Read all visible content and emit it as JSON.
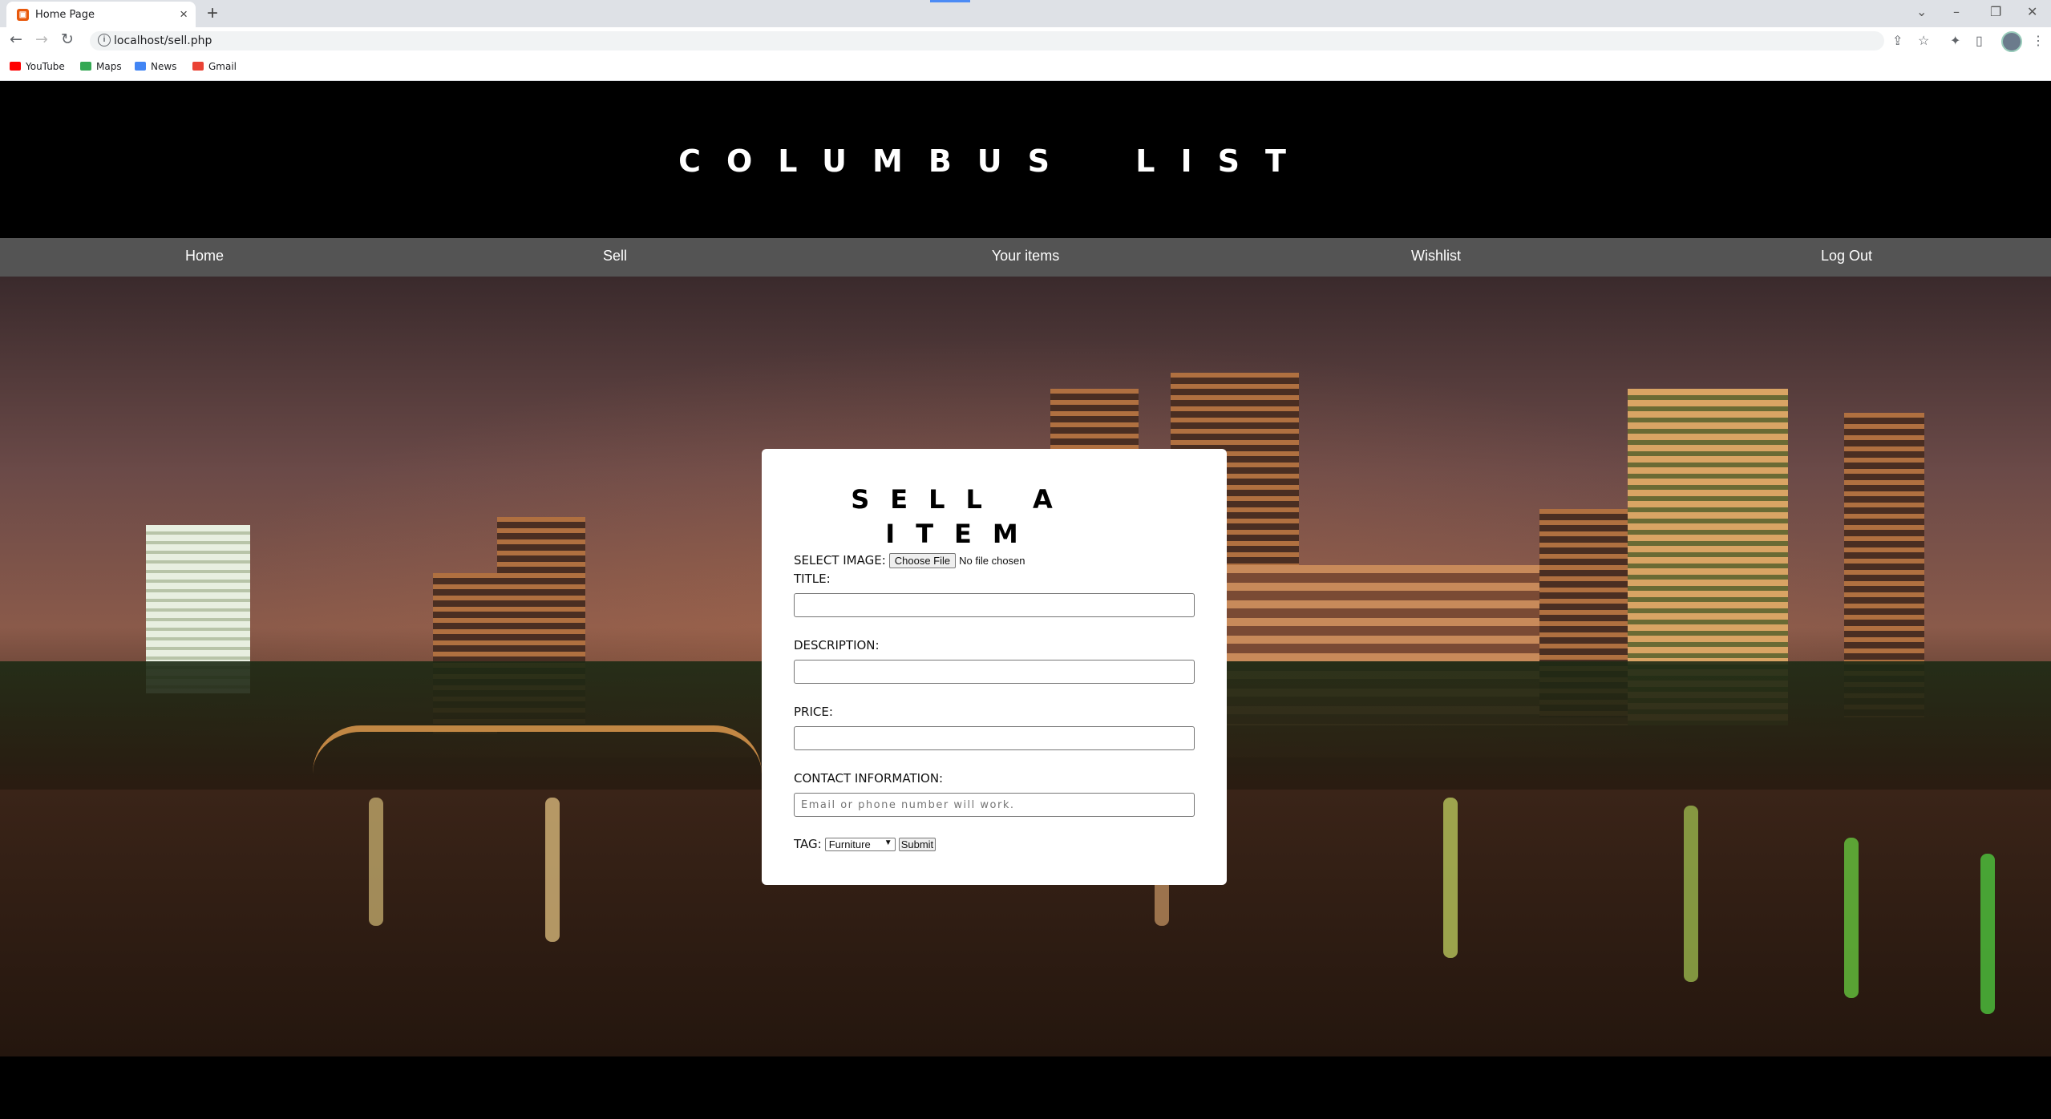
{
  "browser": {
    "tab_title": "Home Page",
    "url": "localhost/sell.php",
    "bookmarks": [
      "YouTube",
      "Maps",
      "News",
      "Gmail"
    ]
  },
  "site": {
    "title": "COLUMBUS LIST",
    "nav": [
      "Home",
      "Sell",
      "Your items",
      "Wishlist",
      "Log Out"
    ]
  },
  "form": {
    "title": "SELL A ITEM",
    "select_image_label": "SELECT IMAGE:",
    "choose_file_label": "Choose File",
    "no_file_text": "No file chosen",
    "title_label": "TITLE:",
    "description_label": "DESCRIPTION:",
    "price_label": "PRICE:",
    "contact_label": "CONTACT INFORMATION:",
    "contact_placeholder": "Email or phone number will work.",
    "tag_label": "TAG:",
    "tag_selected": "Furniture",
    "submit_label": "Submit"
  }
}
